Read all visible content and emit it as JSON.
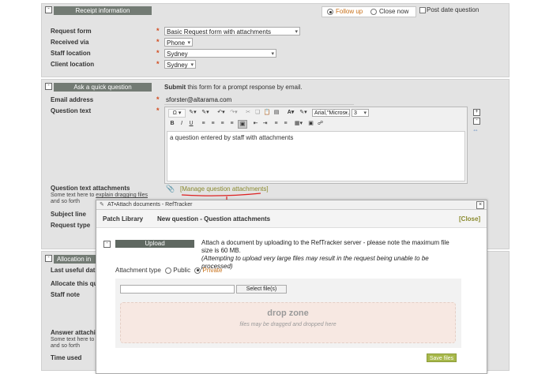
{
  "receipt": {
    "title": "Receipt information",
    "follow_up": "Follow up",
    "close_now": "Close now",
    "post_date": "Post date question",
    "request_form_label": "Request form",
    "request_form_value": "Basic Request form with attachments",
    "received_via_label": "Received via",
    "received_via_value": "Phone",
    "staff_location_label": "Staff location",
    "staff_location_value": "Sydney",
    "client_location_label": "Client location",
    "client_location_value": "Sydney"
  },
  "question": {
    "title": "Ask a quick question",
    "submit_bold": "Submit",
    "submit_rest": "this form for a prompt response by email.",
    "email_label": "Email address",
    "email_value": "sforster@altarama.com",
    "text_label": "Question text",
    "font_name": "Arial,\"Micros...",
    "font_size": "3",
    "editor_text": "a question entered by staff with attachments",
    "attachments_label": "Question text attachments",
    "attachments_help_1": "Some text here to",
    "attachments_help_link": "explain dragging files",
    "attachments_help_2": "and so forth",
    "manage_link": "[Manage question attachments]",
    "subject_label": "Subject line",
    "request_type_label": "Request type"
  },
  "allocation": {
    "title": "Allocation in",
    "last_useful": "Last useful dat",
    "allocate": "Allocate this qu",
    "staff_note": "Staff note",
    "answer_attach": "Answer attachi",
    "help_1": "Some text here to",
    "help_2": "and so forth",
    "time_used": "Time used"
  },
  "dialog": {
    "window_title": "AT•Attach documents - RefTracker",
    "patch_library": "Patch Library",
    "heading": "New question - Question attachments",
    "close": "[Close]",
    "upload_btn": "Upload",
    "attach_text": "Attach a document by uploading to the RefTracker server - please note the maximum file size is 60 MB.",
    "attach_note": "(Attempting to upload very large files may result in the request being unable to be processed)",
    "attachment_type_label": "Attachment type",
    "public": "Public",
    "private": "Private",
    "select_files": "Select file(s)",
    "drop_zone": "drop zone",
    "drop_hint": "files may be dragged and dropped here",
    "save_files": "Save files"
  },
  "colors": {
    "section_title_bg": "#737b74",
    "required_star": "#d24a1e",
    "accent_orange": "#c8711a",
    "link_olive": "#8a8a2e",
    "drop_zone_bg": "#f7e8e2",
    "save_btn": "#a7b84a"
  }
}
